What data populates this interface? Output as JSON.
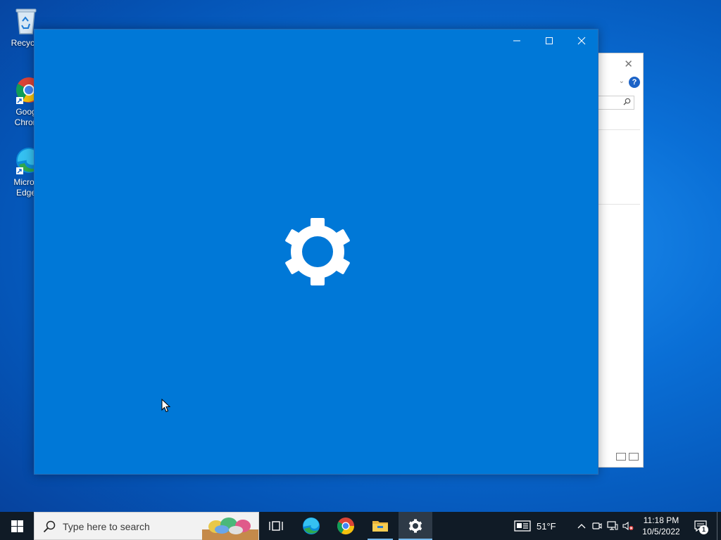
{
  "desktop": {
    "icons": [
      {
        "label": "Recycle",
        "icon": "recycle-bin-icon"
      },
      {
        "label": "Goog Chron",
        "icon": "chrome-icon"
      },
      {
        "label": "Micros Edge",
        "icon": "edge-icon"
      }
    ]
  },
  "settings_window": {
    "icon": "gear-icon",
    "background": "#0078d7",
    "controls": {
      "minimize": "minimize-icon",
      "maximize": "maximize-icon",
      "close": "close-icon"
    }
  },
  "background_window": {
    "help_label": "?"
  },
  "taskbar": {
    "search_placeholder": "Type here to search",
    "apps": [
      "task-view-icon",
      "edge-icon",
      "chrome-icon",
      "file-explorer-icon",
      "settings-icon"
    ],
    "weather_temp": "51°F",
    "clock_time": "11:18 PM",
    "clock_date": "10/5/2022",
    "notification_count": "1"
  },
  "colors": {
    "accent": "#0078d7",
    "taskbar": "#101b26",
    "active_indicator": "#76b9ed"
  }
}
